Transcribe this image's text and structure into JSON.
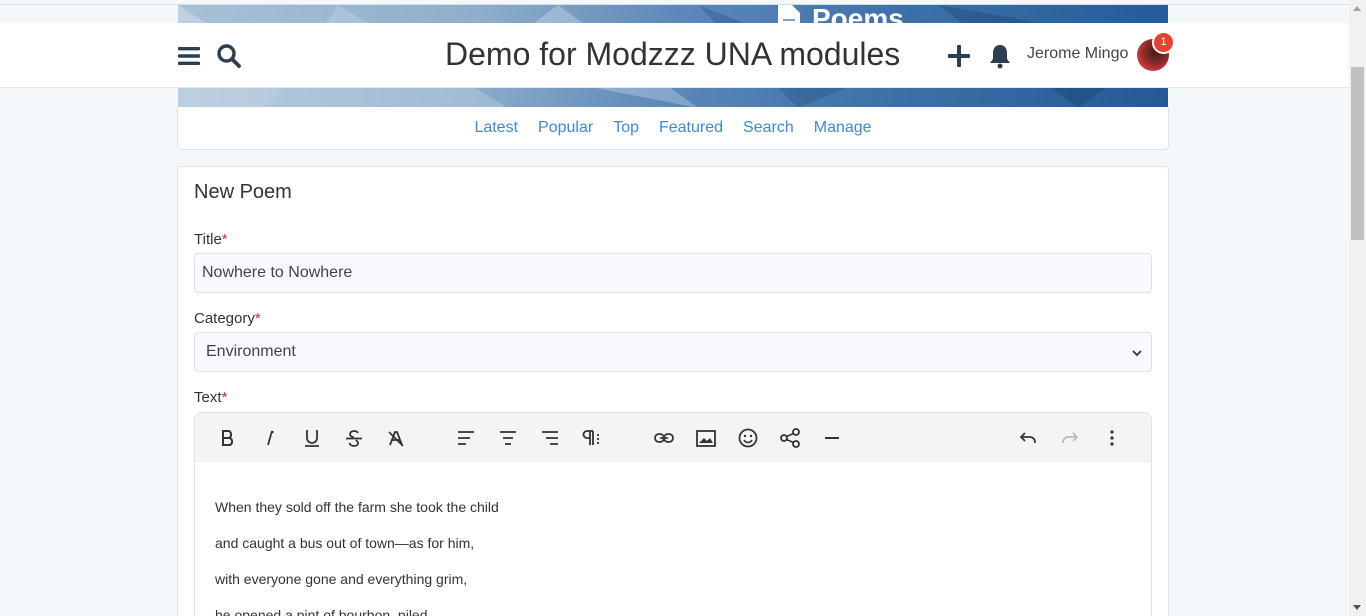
{
  "cover": {
    "title": "Poems"
  },
  "header": {
    "site_title": "Demo for Modzzz UNA modules",
    "user_name": "Jerome Mingo",
    "notification_count": "1"
  },
  "subnav": {
    "items": [
      "Latest",
      "Popular",
      "Top",
      "Featured",
      "Search",
      "Manage"
    ]
  },
  "form": {
    "heading": "New Poem",
    "title_label": "Title",
    "title_value": "Nowhere to Nowhere",
    "category_label": "Category",
    "category_value": "Environment",
    "text_label": "Text",
    "required_mark": "*",
    "text_lines": [
      "When they sold off the farm she took the child",
      "and caught a bus out of town—as for him,",
      "with everyone gone and everything grim,",
      "he opened a pint of bourbon, piled"
    ]
  },
  "toolbar_icons": [
    "bold-icon",
    "italic-icon",
    "underline-icon",
    "strikethrough-icon",
    "clear-format-icon",
    "align-left-icon",
    "align-center-icon",
    "align-right-icon",
    "paragraph-icon",
    "link-icon",
    "image-icon",
    "emoji-icon",
    "share-icon",
    "horizontal-rule-icon",
    "undo-icon",
    "redo-icon",
    "more-icon"
  ],
  "colors": {
    "link": "#3f89d8",
    "required": "#d9263a",
    "badge": "#e8412f"
  }
}
